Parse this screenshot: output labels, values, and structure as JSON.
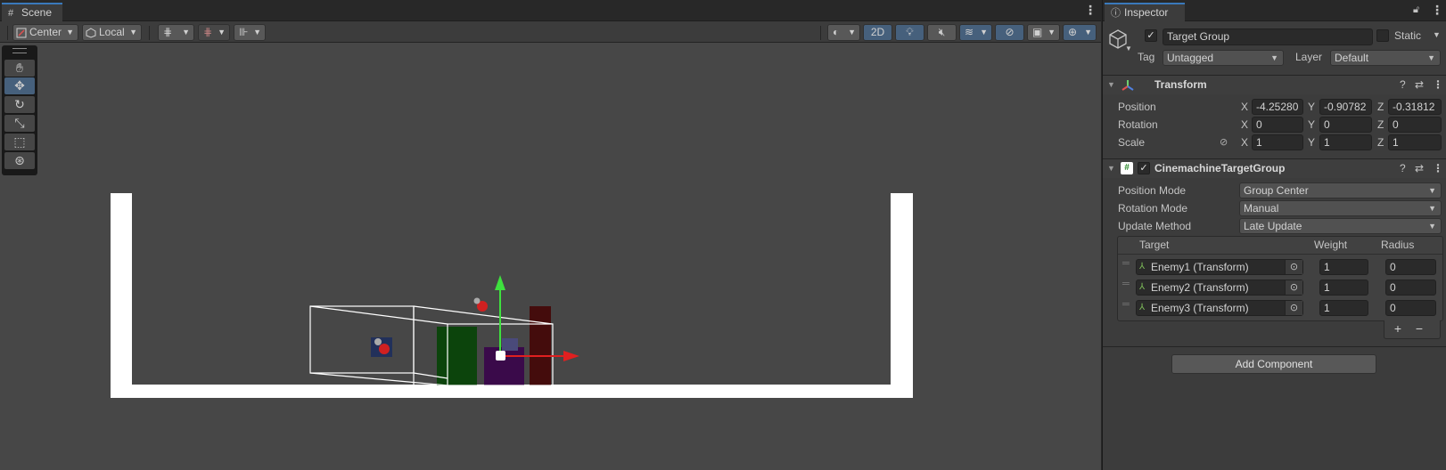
{
  "scene_panel": {
    "tab_label": "Scene",
    "toolbar": {
      "pivot_label": "Center",
      "space_label": "Local",
      "mode_2d_label": "2D"
    },
    "tools": [
      "hand-tool",
      "move-tool",
      "rotate-tool",
      "scale-tool",
      "rect-tool",
      "transform-tool"
    ]
  },
  "inspector": {
    "tab_label": "Inspector",
    "object": {
      "name": "Target Group",
      "static_label": "Static",
      "tag_label": "Tag",
      "tag_value": "Untagged",
      "layer_label": "Layer",
      "layer_value": "Default"
    },
    "transform": {
      "title": "Transform",
      "position_label": "Position",
      "rotation_label": "Rotation",
      "scale_label": "Scale",
      "x_label": "X",
      "y_label": "Y",
      "z_label": "Z",
      "position": [
        "-4.25280",
        "-0.90782",
        "-0.31812"
      ],
      "rotation": [
        "0",
        "0",
        "0"
      ],
      "scale": [
        "1",
        "1",
        "1"
      ]
    },
    "target_group": {
      "title": "CinemachineTargetGroup",
      "position_mode_label": "Position Mode",
      "position_mode_value": "Group Center",
      "rotation_mode_label": "Rotation Mode",
      "rotation_mode_value": "Manual",
      "update_method_label": "Update Method",
      "update_method_value": "Late Update",
      "col_target": "Target",
      "col_weight": "Weight",
      "col_radius": "Radius",
      "targets": [
        {
          "name": "Enemy1 (Transform)",
          "weight": "1",
          "radius": "0"
        },
        {
          "name": "Enemy2 (Transform)",
          "weight": "1",
          "radius": "0"
        },
        {
          "name": "Enemy3 (Transform)",
          "weight": "1",
          "radius": "0"
        }
      ],
      "add_symbol": "+",
      "remove_symbol": "−"
    },
    "add_component_label": "Add Component"
  },
  "colors": {
    "scene_bg": "#474747",
    "inspector_bg": "#3c3c3c",
    "accent": "#3a79bb",
    "active_button": "#46607c"
  }
}
